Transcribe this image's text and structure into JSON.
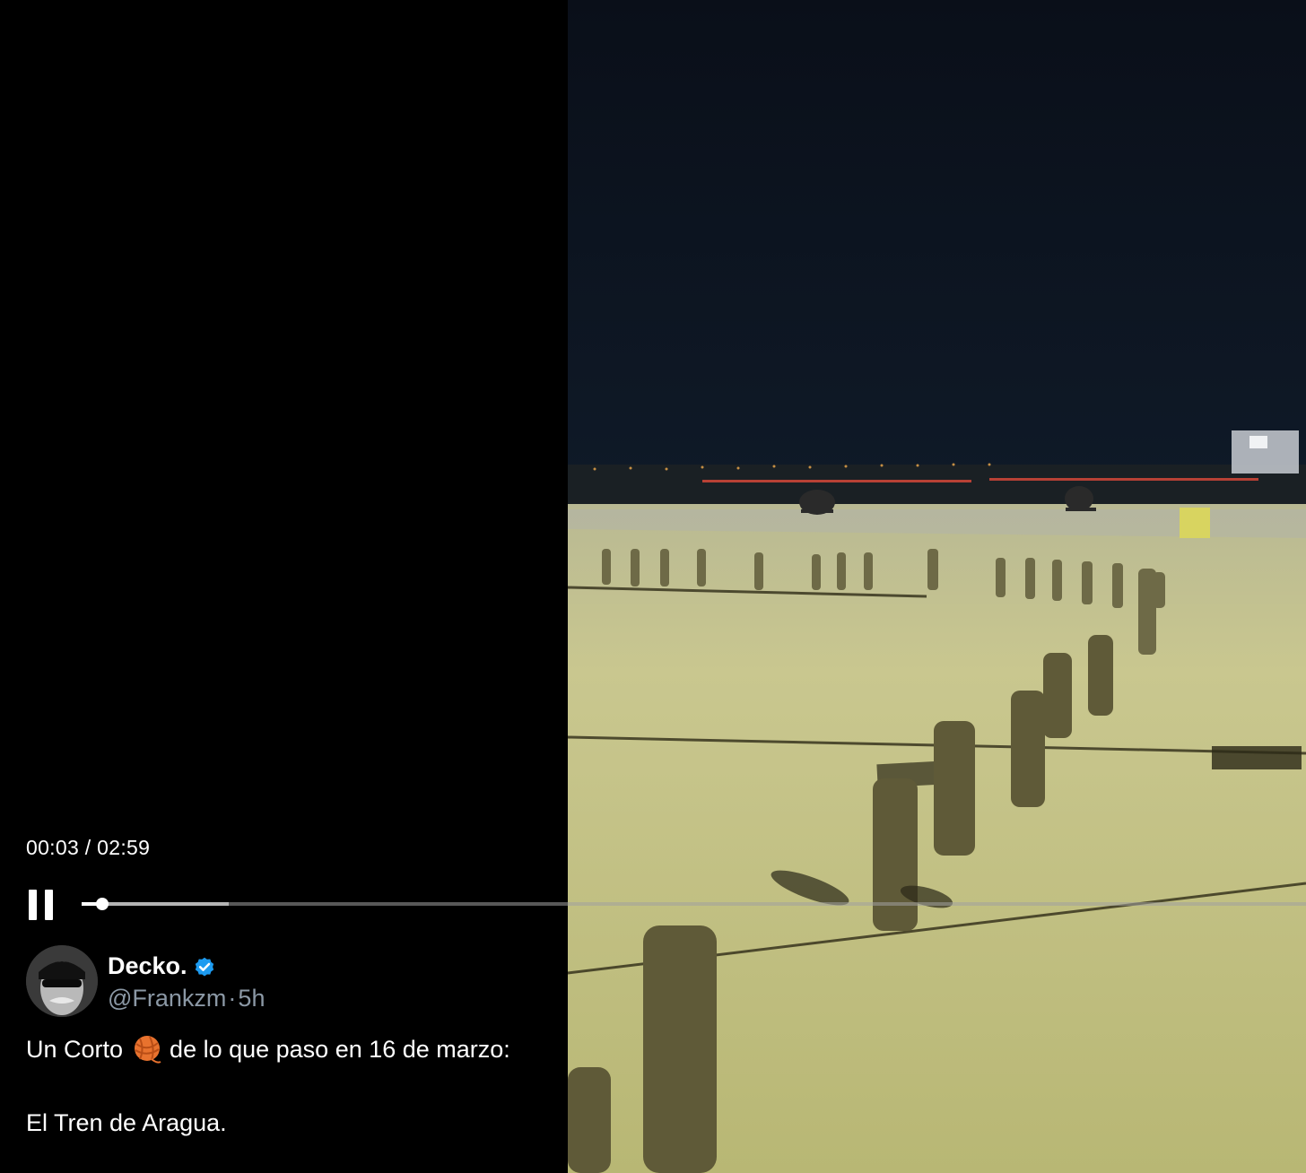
{
  "player": {
    "time_current": "00:03",
    "time_separator": " / ",
    "time_total": "02:59",
    "progress_fraction": 0.017,
    "buffered_fraction": 0.12
  },
  "author": {
    "display_name": "Decko.",
    "handle": "@Frankzm",
    "separator": "·",
    "age": "5h",
    "verified": true
  },
  "tweet": {
    "line1_before": "Un Corto",
    "line1_emoji": "yarn-ball",
    "line1_after": "de lo que paso en 16 de marzo:",
    "line2": "El Tren de Aragua."
  },
  "colors": {
    "verified_badge": "#1d9bf0",
    "muted_text": "#8b98a5",
    "background": "#000000",
    "tarmac": "#c7c58a",
    "night_sky": "#070d18"
  }
}
